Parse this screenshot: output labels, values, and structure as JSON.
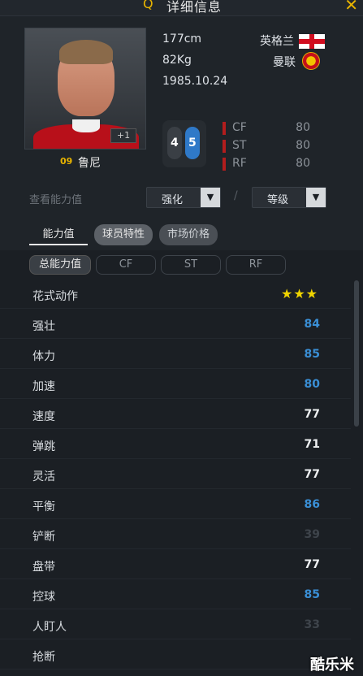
{
  "window": {
    "title": "详细信息"
  },
  "player": {
    "name": "鲁尼",
    "number": "09",
    "plus_badge": "+1",
    "height": "177cm",
    "weight": "82Kg",
    "birthdate": "1985.10.24",
    "nation": "英格兰",
    "club": "曼联",
    "weak_foot_left": "4",
    "weak_foot_right": "5",
    "positions": [
      {
        "pos": "CF",
        "val": "80"
      },
      {
        "pos": "ST",
        "val": "80"
      },
      {
        "pos": "RF",
        "val": "80"
      }
    ]
  },
  "view": {
    "label": "查看能力值",
    "enhance_select": "强化",
    "level_select": "等级",
    "separator": "/"
  },
  "tabs": [
    "能力值",
    "球员特性",
    "市场价格"
  ],
  "subtabs": [
    "总能力值",
    "CF",
    "ST",
    "RF"
  ],
  "stats": [
    {
      "label": "花式动作",
      "value": "★★★",
      "kind": "stars"
    },
    {
      "label": "强壮",
      "value": "84",
      "kind": "blue"
    },
    {
      "label": "体力",
      "value": "85",
      "kind": "blue"
    },
    {
      "label": "加速",
      "value": "80",
      "kind": "blue"
    },
    {
      "label": "速度",
      "value": "77",
      "kind": "white"
    },
    {
      "label": "弹跳",
      "value": "71",
      "kind": "white"
    },
    {
      "label": "灵活",
      "value": "77",
      "kind": "white"
    },
    {
      "label": "平衡",
      "value": "86",
      "kind": "blue"
    },
    {
      "label": "铲断",
      "value": "39",
      "kind": "dim"
    },
    {
      "label": "盘带",
      "value": "77",
      "kind": "white"
    },
    {
      "label": "控球",
      "value": "85",
      "kind": "blue"
    },
    {
      "label": "人盯人",
      "value": "33",
      "kind": "dim"
    },
    {
      "label": "抢断",
      "value": "",
      "kind": "dim"
    }
  ],
  "watermark": "酷乐米",
  "colors": {
    "accent": "#e8b400",
    "blue_stat": "#3a8fd6",
    "position_bar": "#b21d1d"
  },
  "icons": [
    "search-icon",
    "close-icon",
    "england-flag-icon",
    "manutd-crest-icon",
    "chevron-down-icon"
  ]
}
